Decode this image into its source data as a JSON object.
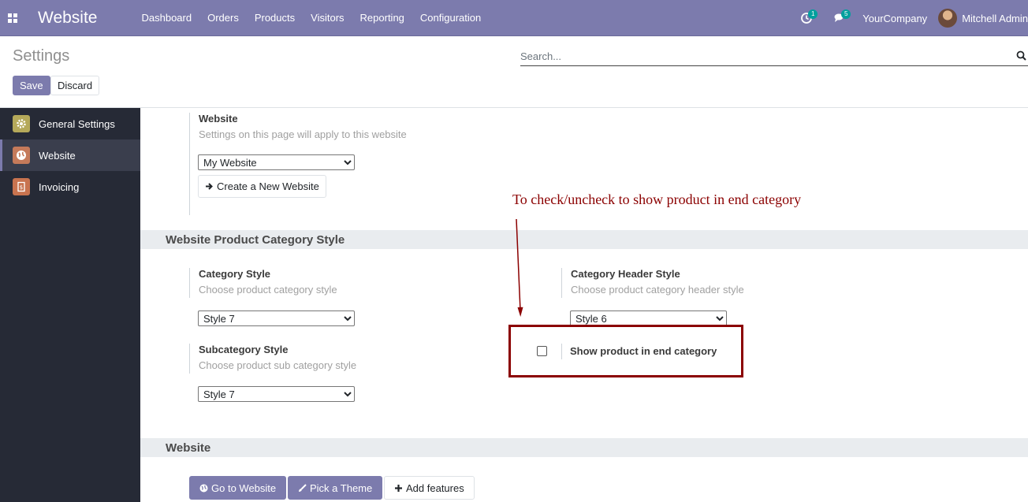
{
  "navbar": {
    "brand": "Website",
    "menu": [
      "Dashboard",
      "Orders",
      "Products",
      "Visitors",
      "Reporting",
      "Configuration"
    ],
    "activity_count": "1",
    "message_count": "5",
    "company": "YourCompany",
    "user": "Mitchell Admin",
    "background": "#7c7bad"
  },
  "control": {
    "title": "Settings",
    "save_label": "Save",
    "discard_label": "Discard",
    "search_placeholder": "Search..."
  },
  "sidebar": {
    "items": [
      {
        "label": "General Settings",
        "icon": "gear-icon",
        "color": "#b5a95a"
      },
      {
        "label": "Website",
        "icon": "globe-icon",
        "color": "#c57a5a"
      },
      {
        "label": "Invoicing",
        "icon": "invoice-icon",
        "color": "#c8734f"
      }
    ],
    "active": "Website"
  },
  "website_section": {
    "label": "Website",
    "description": "Settings on this page will apply to this website",
    "selected": "My Website",
    "create_label": "Create a New Website"
  },
  "category_section": {
    "title": "Website Product Category Style",
    "category_style": {
      "label": "Category Style",
      "description": "Choose product category style",
      "selected": "Style 7"
    },
    "subcategory_style": {
      "label": "Subcategory Style",
      "description": "Choose product sub category style",
      "selected": "Style 7"
    },
    "header_style": {
      "label": "Category Header Style",
      "description": "Choose product category header style",
      "selected": "Style 6"
    },
    "end_category": {
      "label": "Show product in end category",
      "checked": false
    }
  },
  "bottom_section": {
    "title": "Website",
    "go_label": "Go to Website",
    "theme_label": "Pick a Theme",
    "features_label": "Add features"
  },
  "annotation": {
    "text": "To check/uncheck to show product in end category",
    "color": "#8b0000"
  }
}
